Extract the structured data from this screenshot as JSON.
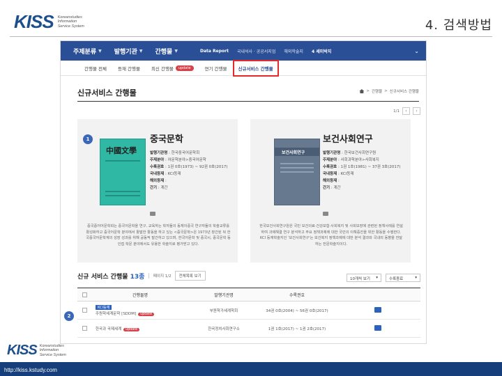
{
  "slide": {
    "logo_text": "KISS",
    "logo_sub": [
      "Koreanstudies",
      "Information",
      "Service System"
    ],
    "title": "4. 검색방법",
    "footer_url": "http://kiss.kstudy.com"
  },
  "gnb": {
    "items": [
      "주제분류",
      "발행기관",
      "간행물"
    ],
    "links": [
      "Data Report",
      "국내석사 · 공공서지업",
      "해외학술지"
    ],
    "highlight": "4 세미박지"
  },
  "lnb": {
    "items": [
      "간행물 전체",
      "등재 간행물",
      "최신 간행물",
      "연기 간행물"
    ],
    "update_label": "update",
    "active": "신규서비스 간행물"
  },
  "page": {
    "title": "신규서비스 간행물",
    "breadcrumb": [
      "간행물",
      "신규서비스 간행물"
    ],
    "pager": "1/1"
  },
  "cards": [
    {
      "num": "1",
      "title": "중국문학",
      "cover_title": "中國文學",
      "meta": [
        [
          "발행기관명",
          "한국중국어문학회"
        ],
        [
          "주제분야",
          "어문학분야>중국어문학"
        ],
        [
          "수록권호",
          "1권 0호(1973) ~ 92권 0호(2017)"
        ],
        [
          "국내등재",
          "KCI등재"
        ],
        [
          "해외등재",
          ""
        ],
        [
          "간기",
          "계간"
        ]
      ],
      "desc": "중국중어어문학회는 중국어문학을 연구, 교육하는 학자들의 동체이중국 연구자들의 학술교류를 활성화하고 중국어문학 분야에서 활발한 활동을 하고 있는 <중국문학>은 1973년 창간된 뒤 한국중국어문학계의 성장 성과를 위해 공동적 발간하고 있으며, 한국어문학 및 중국시, 중국문학 등 인접 학문 분야에서도 유용한 학술지로 평가받고 있다."
    },
    {
      "num": "",
      "title": "보건사회연구",
      "cover_title": "보건사회연구",
      "meta": [
        [
          "발행기관명",
          "한국보건사회연구원"
        ],
        [
          "주제분야",
          "사회과학분야>사회복지"
        ],
        [
          "수록권호",
          "1권 1호(1981) ~ 37권 3호(2017)"
        ],
        [
          "국내등재",
          "KCI등재"
        ],
        [
          "해외등재",
          ""
        ],
        [
          "간기",
          "계간"
        ]
      ],
      "desc": "한국보건사회연구원은 국민 보건의료·건강보험·사회복지 및 사회보장에 관련된 정책사례를 연설하여 과제해결 연구 분석하고 주요 정책과제에 대한 국민의 이해증진을 위한 활동을 수행한다. KCI 등재학술지인 '보건사회연구'는 보건복지 정책과제에 대한 분석 결과와 국내외 동향을 전달하는 전문학술지이다."
    }
  ],
  "list": {
    "title": "신규 서비스 간행물",
    "count": "13종",
    "page": "페이지 1/2",
    "select_button": "전체목록 보기",
    "per_page": "10개씩 보기",
    "sort": "수록종료",
    "columns": [
      "간행물명",
      "발행기관명",
      "수록권호",
      ""
    ],
    "rows": [
      {
        "kci": "KCI등재",
        "name": "주원학세계문학 [SDDM]",
        "update": "update",
        "publisher": "부원학가세계학회",
        "years": "34권 0호(2004) ~ 56권 0호(2017)"
      },
      {
        "kci": "",
        "name": "한국과 국제세계",
        "update": "update",
        "publisher": "한국정치사회연구소",
        "years": "1권 1호(2017) ~ 1권 2호(2017)"
      }
    ]
  },
  "annotations": {
    "n2": "2"
  }
}
